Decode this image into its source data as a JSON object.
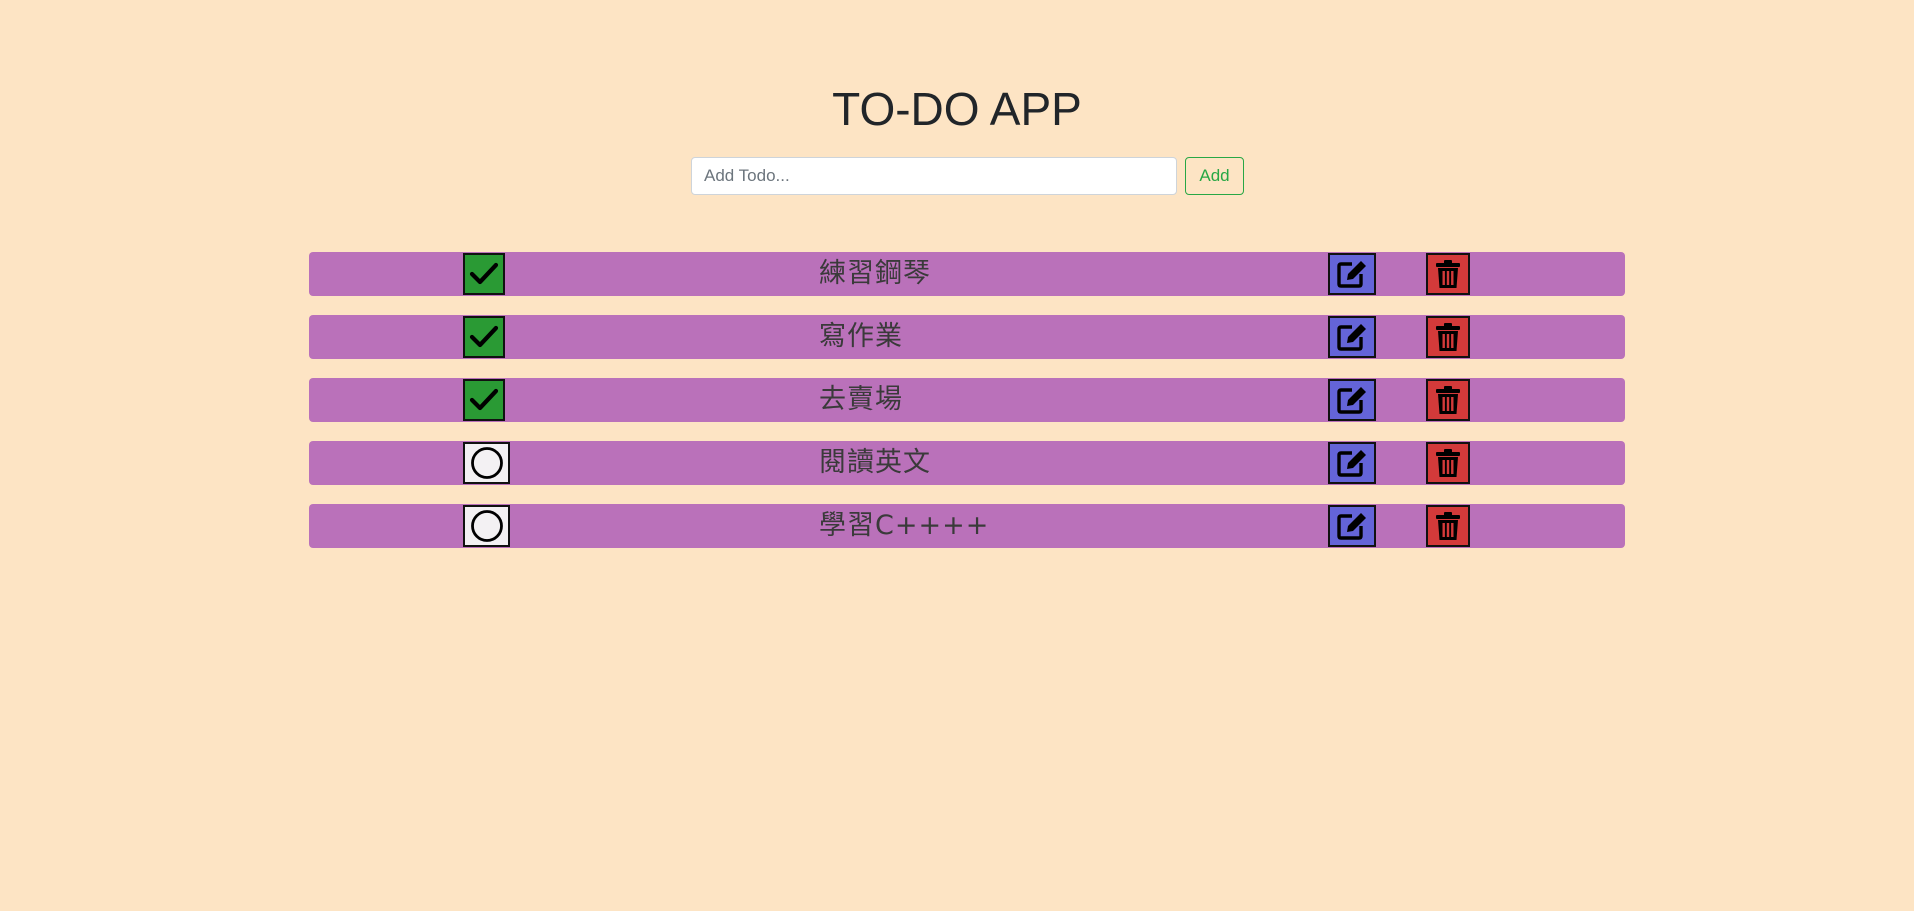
{
  "header": {
    "title": "TO-DO APP"
  },
  "add_form": {
    "placeholder": "Add Todo...",
    "value": "",
    "add_label": "Add"
  },
  "colors": {
    "background": "#fde4c4",
    "row": "#ba71ba",
    "done": "#2a9a34",
    "edit": "#6464d8",
    "delete": "#d33a3a",
    "add_outline": "#28a745"
  },
  "todos": [
    {
      "text": "練習鋼琴",
      "completed": true
    },
    {
      "text": "寫作業",
      "completed": true
    },
    {
      "text": "去賣場",
      "completed": true
    },
    {
      "text": "閱讀英文",
      "completed": false
    },
    {
      "text": "學習C++++",
      "completed": false
    }
  ],
  "icons": {
    "done": "check-icon",
    "pending": "circle-icon",
    "edit": "edit-icon",
    "delete": "trash-icon"
  }
}
